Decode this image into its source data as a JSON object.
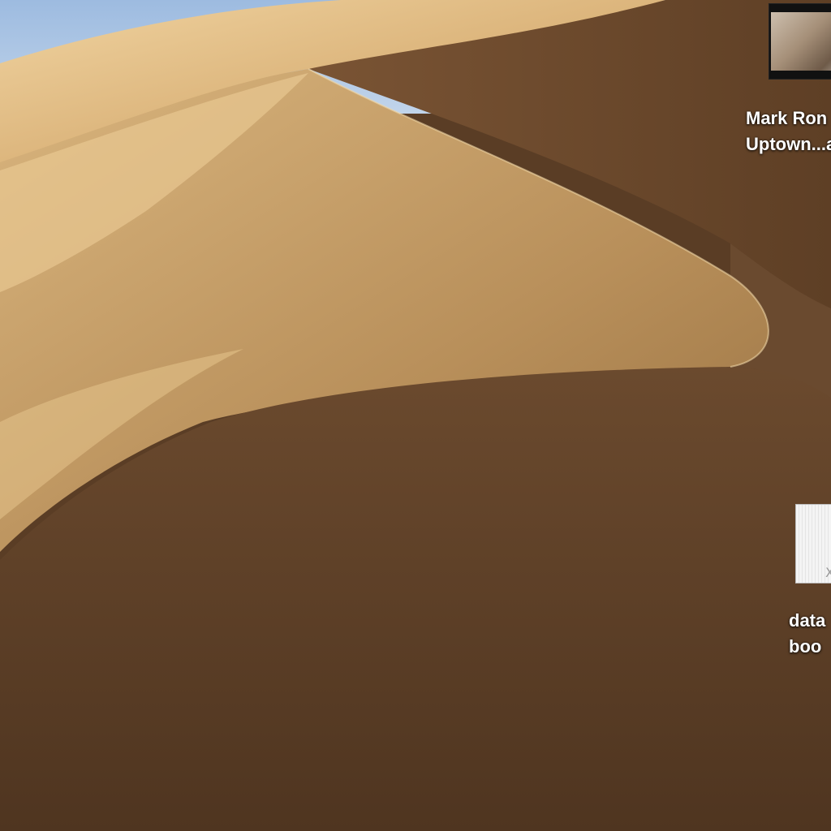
{
  "desktop": {
    "wallpaper": {
      "name": "desert-dunes-wallpaper",
      "sky_color": "#a9c3e4",
      "light_sand_color": "#e3c28e",
      "shadow_sand_color": "#5d3f26"
    },
    "icons": [
      {
        "id": "video-file",
        "icon": "video-thumbnail-icon",
        "label_line1": "Mark Ron",
        "label_line2": "Uptown...a"
      },
      {
        "id": "document-file",
        "icon": "document-icon",
        "glyph": "X",
        "label_line1": "data",
        "label_line2": "boo"
      }
    ]
  }
}
